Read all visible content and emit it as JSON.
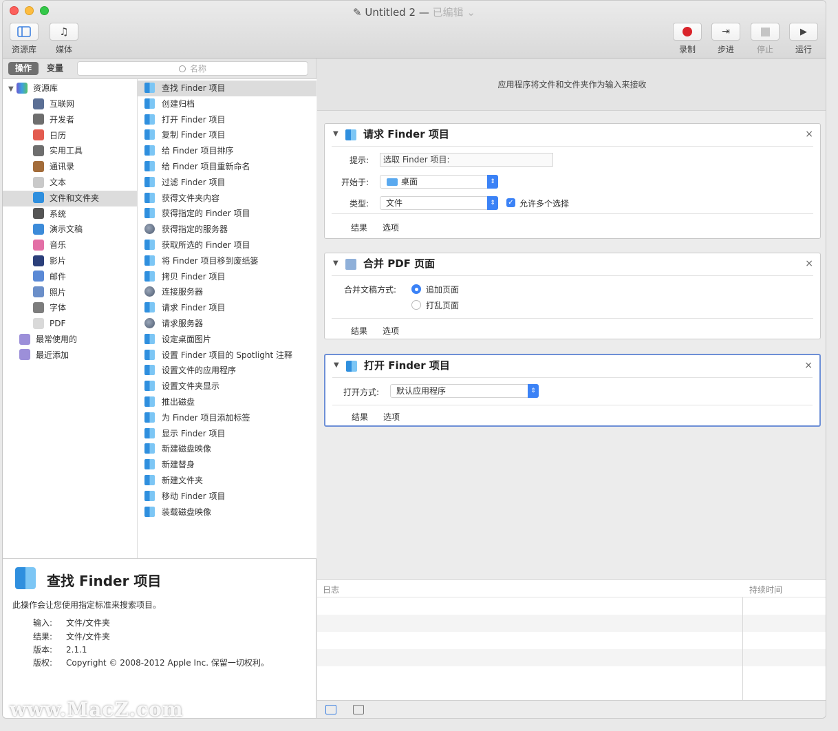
{
  "window": {
    "title": "Untitled 2",
    "title_separator": "—",
    "edited_label": "已编辑",
    "edited_chevron": "⌄"
  },
  "toolbar": {
    "library_label": "资源库",
    "media_label": "媒体",
    "record_label": "录制",
    "step_label": "步进",
    "stop_label": "停止",
    "run_label": "运行"
  },
  "filter": {
    "actions_tab": "操作",
    "variables_tab": "变量",
    "search_placeholder": "名称"
  },
  "library": {
    "root_label": "资源库",
    "items": [
      {
        "label": "互联网",
        "icon": "globe-icon",
        "color": "#5b6f95"
      },
      {
        "label": "开发者",
        "icon": "tools-icon",
        "color": "#6e6e6e"
      },
      {
        "label": "日历",
        "icon": "calendar-icon",
        "color": "#e35b4f"
      },
      {
        "label": "实用工具",
        "icon": "tools-icon",
        "color": "#6e6e6e"
      },
      {
        "label": "通讯录",
        "icon": "contacts-icon",
        "color": "#a36c3a"
      },
      {
        "label": "文本",
        "icon": "text-icon",
        "color": "#c9c9c9"
      },
      {
        "label": "文件和文件夹",
        "icon": "finder-icon",
        "color": "#2f8fde"
      },
      {
        "label": "系统",
        "icon": "system-icon",
        "color": "#555555"
      },
      {
        "label": "演示文稿",
        "icon": "presentation-icon",
        "color": "#3c8bd9"
      },
      {
        "label": "音乐",
        "icon": "music-icon",
        "color": "#e36fa6"
      },
      {
        "label": "影片",
        "icon": "movie-icon",
        "color": "#2b3f7a"
      },
      {
        "label": "邮件",
        "icon": "mail-icon",
        "color": "#5a89d6"
      },
      {
        "label": "照片",
        "icon": "photos-icon",
        "color": "#6b8fc9"
      },
      {
        "label": "字体",
        "icon": "fonts-icon",
        "color": "#7d7d7d"
      },
      {
        "label": "PDF",
        "icon": "pdf-icon",
        "color": "#d9d9d9"
      }
    ],
    "smart_folders": [
      {
        "label": "最常使用的",
        "icon": "smart-folder-icon",
        "color": "#9c8fd9"
      },
      {
        "label": "最近添加",
        "icon": "smart-folder-icon",
        "color": "#9c8fd9"
      }
    ],
    "selected_index": 6
  },
  "actions": {
    "items": [
      {
        "label": "查找 Finder 项目",
        "icon": "finder"
      },
      {
        "label": "创建归档",
        "icon": "finder"
      },
      {
        "label": "打开 Finder 项目",
        "icon": "finder"
      },
      {
        "label": "复制 Finder 项目",
        "icon": "finder"
      },
      {
        "label": "给 Finder 项目排序",
        "icon": "finder"
      },
      {
        "label": "给 Finder 项目重新命名",
        "icon": "finder"
      },
      {
        "label": "过滤 Finder 项目",
        "icon": "finder"
      },
      {
        "label": "获得文件夹内容",
        "icon": "finder"
      },
      {
        "label": "获得指定的 Finder 项目",
        "icon": "finder"
      },
      {
        "label": "获得指定的服务器",
        "icon": "globe"
      },
      {
        "label": "获取所选的 Finder 项目",
        "icon": "finder"
      },
      {
        "label": "将 Finder 项目移到废纸篓",
        "icon": "finder"
      },
      {
        "label": "拷贝 Finder 项目",
        "icon": "finder"
      },
      {
        "label": "连接服务器",
        "icon": "globe"
      },
      {
        "label": "请求 Finder 项目",
        "icon": "finder"
      },
      {
        "label": "请求服务器",
        "icon": "globe"
      },
      {
        "label": "设定桌面图片",
        "icon": "finder"
      },
      {
        "label": "设置 Finder 项目的 Spotlight 注释",
        "icon": "finder"
      },
      {
        "label": "设置文件的应用程序",
        "icon": "finder"
      },
      {
        "label": "设置文件夹显示",
        "icon": "finder"
      },
      {
        "label": "推出磁盘",
        "icon": "finder"
      },
      {
        "label": "为 Finder 项目添加标签",
        "icon": "finder"
      },
      {
        "label": "显示 Finder 项目",
        "icon": "finder"
      },
      {
        "label": "新建磁盘映像",
        "icon": "finder"
      },
      {
        "label": "新建替身",
        "icon": "finder"
      },
      {
        "label": "新建文件夹",
        "icon": "finder"
      },
      {
        "label": "移动 Finder 项目",
        "icon": "finder"
      },
      {
        "label": "装载磁盘映像",
        "icon": "finder"
      }
    ],
    "selected_index": 0
  },
  "description": {
    "title": "查找 Finder 项目",
    "text": "此操作会让您使用指定标准来搜索项目。",
    "input_key": "输入:",
    "input_val": "文件/文件夹",
    "result_key": "结果:",
    "result_val": "文件/文件夹",
    "version_key": "版本:",
    "version_val": "2.1.1",
    "copyright_key": "版权:",
    "copyright_val": "Copyright © 2008-2012 Apple Inc. 保留一切权利。"
  },
  "workflow": {
    "header_text": "应用程序将文件和文件夹作为输入来接收",
    "action1": {
      "title": "请求 Finder 项目",
      "prompt_label": "提示:",
      "prompt_value": "选取 Finder 项目:",
      "start_label": "开始于:",
      "start_value": "桌面",
      "type_label": "类型:",
      "type_value": "文件",
      "allow_multiple_label": "允许多个选择",
      "results_label": "结果",
      "options_label": "选项"
    },
    "action2": {
      "title": "合并 PDF 页面",
      "combine_label": "合并文稿方式:",
      "option_append": "追加页面",
      "option_shuffle": "打乱页面",
      "results_label": "结果",
      "options_label": "选项"
    },
    "action3": {
      "title": "打开 Finder 项目",
      "open_with_label": "打开方式:",
      "open_with_value": "默认应用程序",
      "results_label": "结果",
      "options_label": "选项"
    }
  },
  "log": {
    "log_label": "日志",
    "duration_label": "持续时间"
  },
  "watermark": "www.MacZ.com"
}
